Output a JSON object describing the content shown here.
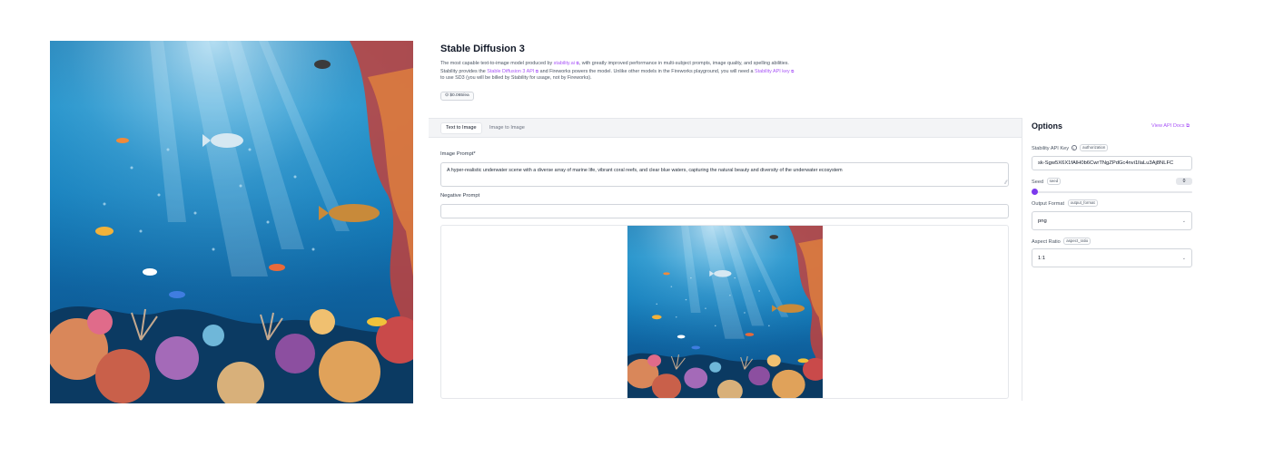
{
  "main_image": {
    "name": "underwater-reef-image"
  },
  "header": {
    "title": "Stable Diffusion 3",
    "desc_1": "The most capable text-to-image model produced by",
    "desc_link_1": "stability.ai",
    "desc_2": ", with greatly improved performance in multi-subject prompts, image quality, and spelling abilities.",
    "desc_3": "Stability provides the",
    "desc_link_2": "Stable Diffusion 3 API",
    "desc_4": "and Fireworks powers the model. Unlike other models in the Fireworks playground, you will need a",
    "desc_link_3": "Stability API key",
    "desc_5": "to use SD3 (you will be billed by Stability for usage, not by Fireworks).",
    "ext_glyph": "⧉",
    "price": "⊙ $0.065/ea"
  },
  "tabs": [
    {
      "label": "Text to Image",
      "active": true
    },
    {
      "label": "Image to Image",
      "active": false
    }
  ],
  "form": {
    "prompt_label": "Image Prompt*",
    "prompt_value": "A hyper-realistic underwater scene with a diverse array of marine life, vibrant coral reefs, and clear blue waters, capturing the natural beauty and diversity of the underwater ecosystem",
    "negative_label": "Negative Prompt",
    "negative_value": ""
  },
  "options": {
    "title": "Options",
    "view_docs": "View API Docs ⧉",
    "api_key_label": "Stability API Key",
    "api_key_tag": "authorization",
    "api_key_value": "sk-Sgw5X6X1fAlH0b6CwrTNgZPdGc4nvi1llaLu3Aj8NLFC",
    "seed_label": "Seed",
    "seed_tag": "seed",
    "seed_value": "0",
    "seed_level": 0,
    "format_label": "Output Format",
    "format_tag": "output_format",
    "format_value": "png",
    "aspect_label": "Aspect Ratio",
    "aspect_tag": "aspect_ratio",
    "aspect_value": "1:1",
    "chevron": "⌄"
  },
  "colors": {
    "accent": "#a855f7",
    "slider_knob": "#7c3aed",
    "water_top": "#1e8fc8",
    "water_deep": "#0b4f86"
  },
  "icons": [
    "external-link-icon",
    "info-icon",
    "chevron-down-icon",
    "coin-icon",
    "resize-grip-icon"
  ]
}
